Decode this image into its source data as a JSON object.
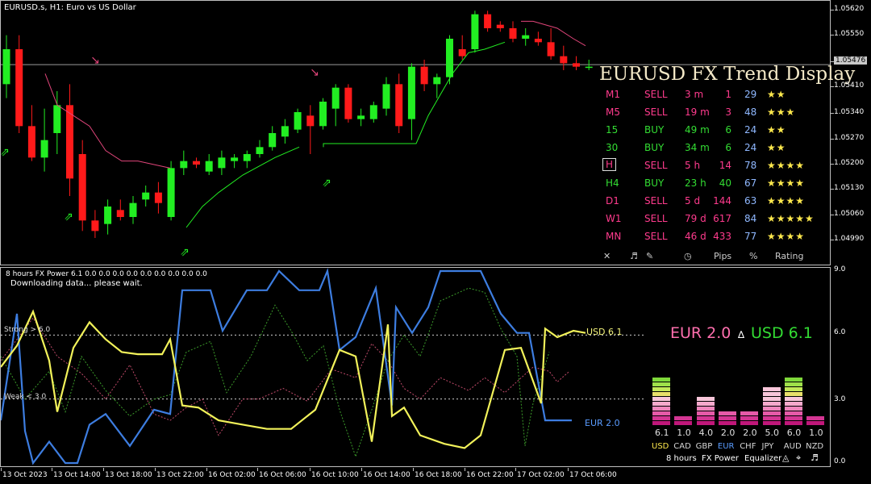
{
  "title": "EURUSD.s, H1:  Euro vs US Dollar",
  "main_yaxis": [
    "1.05620",
    "1.05550",
    "1.05476",
    "1.05410",
    "1.05340",
    "1.05270",
    "1.05200",
    "1.05130",
    "1.05060",
    "1.04990"
  ],
  "current_price": "1.05476",
  "xaxis": [
    "13 Oct 2023",
    "13 Oct 14:00",
    "13 Oct 18:00",
    "13 Oct 22:00",
    "16 Oct 02:00",
    "16 Oct 06:00",
    "16 Oct 10:00",
    "16 Oct 14:00",
    "16 Oct 18:00",
    "16 Oct 22:00",
    "17 Oct 02:00",
    "17 Oct 06:00"
  ],
  "trend_panel": {
    "title": "EURUSD FX Trend Display",
    "rows": [
      {
        "tf": "M1",
        "dir": "SELL",
        "age": "3 m",
        "pips": "1",
        "pct": "29",
        "stars": "★★"
      },
      {
        "tf": "M5",
        "dir": "SELL",
        "age": "19 m",
        "pips": "3",
        "pct": "48",
        "stars": "★★★"
      },
      {
        "tf": "15",
        "dir": "BUY",
        "age": "49 m",
        "pips": "6",
        "pct": "24",
        "stars": "★★"
      },
      {
        "tf": "30",
        "dir": "BUY",
        "age": "34 m",
        "pips": "6",
        "pct": "24",
        "stars": "★★"
      },
      {
        "tf": "H",
        "dir": "SELL",
        "age": "5 h",
        "pips": "14",
        "pct": "78",
        "stars": "★★★★"
      },
      {
        "tf": "H4",
        "dir": "BUY",
        "age": "23 h",
        "pips": "40",
        "pct": "67",
        "stars": "★★★★"
      },
      {
        "tf": "D1",
        "dir": "SELL",
        "age": "5 d",
        "pips": "144",
        "pct": "63",
        "stars": "★★★★"
      },
      {
        "tf": "W1",
        "dir": "SELL",
        "age": "79 d",
        "pips": "617",
        "pct": "84",
        "stars": "★★★★★"
      },
      {
        "tf": "MN",
        "dir": "SELL",
        "age": "46 d",
        "pips": "433",
        "pct": "77",
        "stars": "★★★★"
      }
    ],
    "footer": {
      "close": "✕",
      "pips": "Pips",
      "pct": "%",
      "rating": "Rating"
    },
    "colors": {
      "sell": "#ff3b8d",
      "buy": "#33dd33",
      "num": "#8fb8ff",
      "star": "#ffe94d"
    }
  },
  "indicator": {
    "header": "8 hours FX Power 6.1 0.0 0.0 0.0 0.0 0.0 0.0 0.0 0.0 0.0",
    "status": "Downloading data... please wait.",
    "strong_label": "Strong > 6.0",
    "weak_label": "Weak < 3.0",
    "usd_label": "USD 6.1",
    "eur_label": "EUR 2.0",
    "yaxis": [
      "9.0",
      "6.0",
      "3.0",
      "0.0"
    ],
    "pair_eur": "EUR 2.0",
    "delta": "∆",
    "pair_usd": "USD 6.1",
    "equalizer": {
      "currencies": [
        "USD",
        "CAD",
        "GBP",
        "EUR",
        "CHF",
        "JPY",
        "AUD",
        "NZD"
      ],
      "values": [
        "6.1",
        "1.0",
        "4.0",
        "2.0",
        "2.0",
        "5.0",
        "6.0",
        "1.0"
      ],
      "footer": [
        "8 hours",
        "FX Power",
        "Equalizer",
        "◬",
        "⌖",
        "♬"
      ]
    }
  }
}
